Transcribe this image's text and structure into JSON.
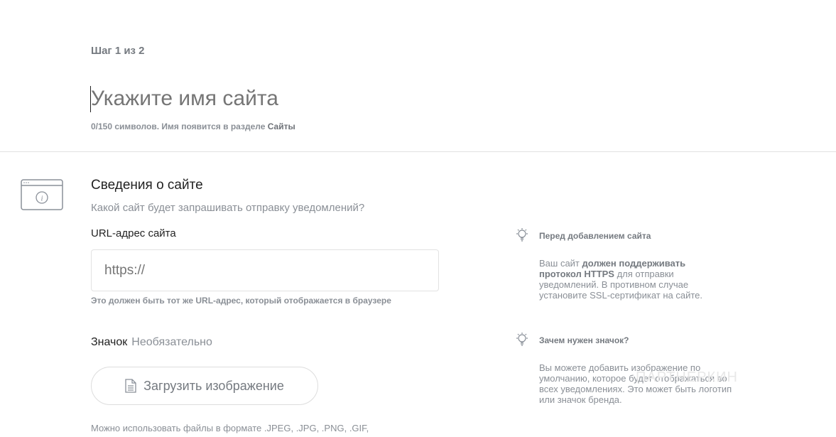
{
  "step": "Шаг 1 из 2",
  "site_name": {
    "placeholder": "Укажите имя сайта",
    "value": "",
    "counter": "0/150 символов. Имя появится в разделе ",
    "counter_bold": "Сайты"
  },
  "section": {
    "title": "Сведения о сайте",
    "subtitle": "Какой сайт будет запрашивать отправку уведомлений?"
  },
  "url": {
    "label": "URL-адрес сайта",
    "placeholder": "https://",
    "hint": "Это должен быть тот же URL-адрес, который отображается в браузере"
  },
  "icon": {
    "label": "Значок",
    "optional": "Необязательно",
    "upload_label": "Загрузить изображение",
    "formats": "Можно использовать файлы в формате .JPEG, .JPG, .PNG, .GIF,"
  },
  "tips": [
    {
      "title": "Перед добавлением сайта",
      "pre": "Ваш сайт ",
      "bold": "должен поддерживать протокол HTTPS",
      "post": " для отправки уведомлений. В противном случае установите SSL-сертификат на сайте."
    },
    {
      "title": "Зачем нужен значок?",
      "pre": "Вы можете добавить изображение по умолчанию, которое будет отображаться во всех уведомлениях. Это может быть логотип или значок бренда.",
      "bold": "",
      "post": ""
    }
  ],
  "watermark": "ПАРТНЕРКИН"
}
